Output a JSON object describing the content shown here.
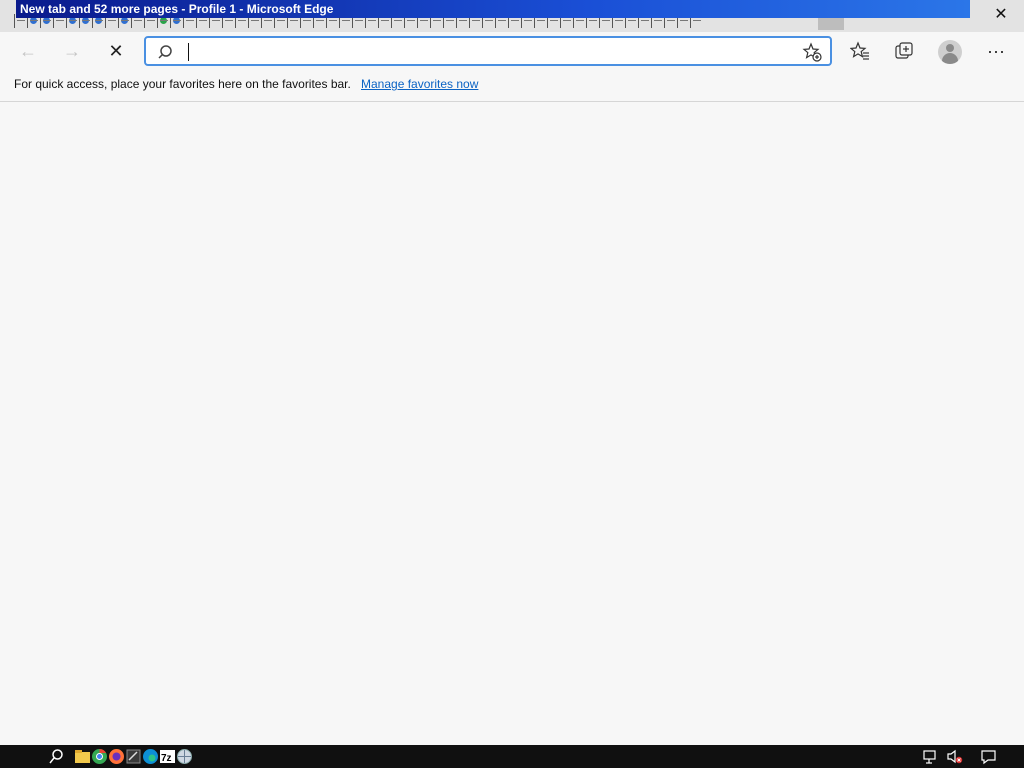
{
  "window": {
    "title": "New tab and 52 more pages - Profile 1 - Microsoft Edge",
    "close_glyph": "✕"
  },
  "toolbar": {
    "back_glyph": "←",
    "forward_glyph": "→",
    "stop_glyph": "✕",
    "more_glyph": "···",
    "address": {
      "value": "",
      "placeholder": ""
    }
  },
  "favorites_bar": {
    "message": "For quick access, place your favorites here on the favorites bar.",
    "link": "Manage favorites now"
  },
  "colors": {
    "accent": "#4a90e2",
    "link": "#0b63c4",
    "title_gradient_start": "#0a1a8c",
    "taskbar": "#101010"
  },
  "icons": {
    "search": "search-icon",
    "add_favorite": "star-plus-icon",
    "favorites": "favorites-icon",
    "collections": "collections-icon",
    "profile": "profile-avatar-icon"
  }
}
